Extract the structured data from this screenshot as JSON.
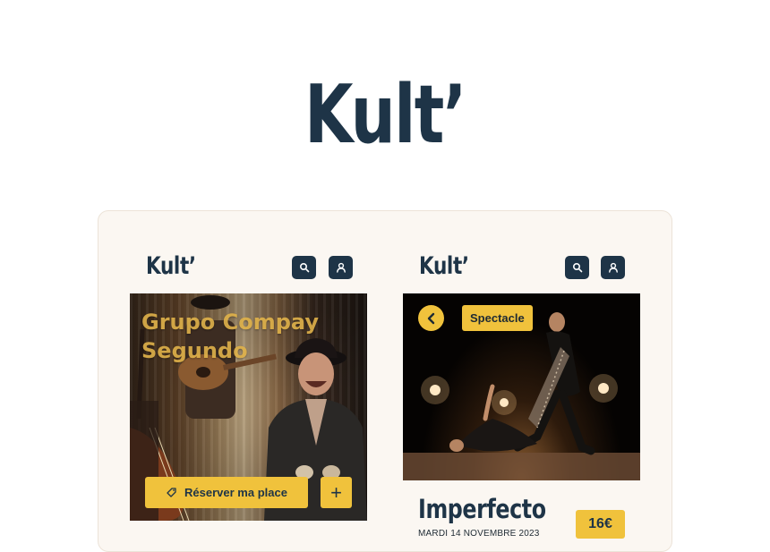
{
  "hero": {
    "logo": "Kult’"
  },
  "left_card": {
    "logo": "Kult’",
    "show_title": "Grupo Compay Segundo",
    "reserve_label": "Réserver ma place",
    "more_label": "+"
  },
  "right_card": {
    "logo": "Kult’",
    "category": "Spectacle",
    "event_title": "Imperfecto",
    "event_date": "MARDI 14 NOVEMBRE 2023",
    "price": "16€"
  },
  "colors": {
    "navy": "#1e3447",
    "accent_yellow": "#f0c23c",
    "panel_bg": "#fbf7f2"
  }
}
